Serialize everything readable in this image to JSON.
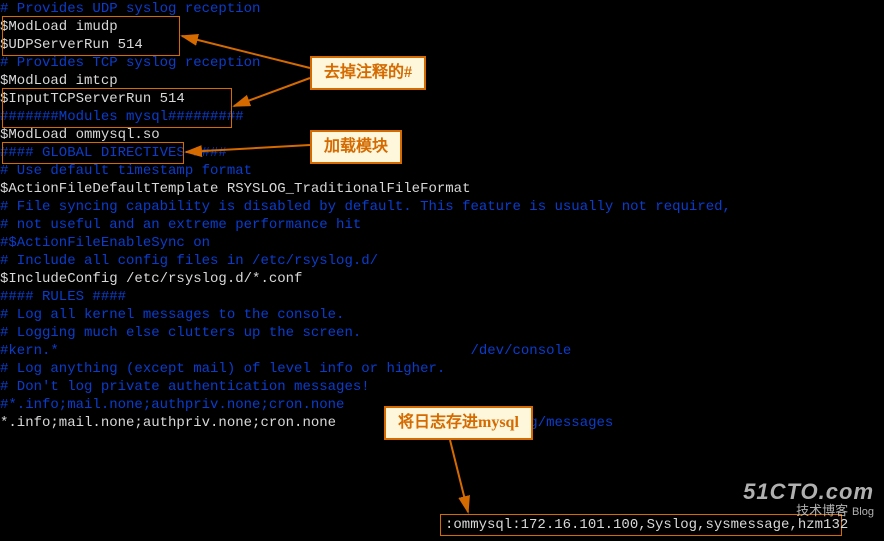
{
  "code": {
    "l1": "# Provides UDP syslog reception",
    "l2": "$ModLoad imudp",
    "l3": "$UDPServerRun 514",
    "l4": "",
    "l5": "# Provides TCP syslog reception",
    "l6": "$ModLoad imtcp",
    "l7": "$InputTCPServerRun 514",
    "l8": "#######Modules mysql#########",
    "l9": "$ModLoad ommysql.so",
    "l10": "",
    "l11": "#### GLOBAL DIRECTIVES ####",
    "l12": "",
    "l13": "# Use default timestamp format",
    "l14": "$ActionFileDefaultTemplate RSYSLOG_TraditionalFileFormat",
    "l15": "",
    "l16": "# File syncing capability is disabled by default. This feature is usually not required,",
    "l17": "# not useful and an extreme performance hit",
    "l18": "#$ActionFileEnableSync on",
    "l19": "",
    "l20": "# Include all config files in /etc/rsyslog.d/",
    "l21": "$IncludeConfig /etc/rsyslog.d/*.conf",
    "l22": "",
    "l23": "",
    "l24": "#### RULES ####",
    "l25": "",
    "l26": "# Log all kernel messages to the console.",
    "l27": "# Logging much else clutters up the screen.",
    "l28": "#kern.*                                                 /dev/console",
    "l29": "",
    "l30": "# Log anything (except mail) of level info or higher.",
    "l31": "# Don't log private authentication messages!",
    "l32": "#*.info;mail.none;authpriv.none;cron.none",
    "l33a": "*.info;mail.none;authpriv.none;cron.none",
    "l33b": "                /var/log/messages",
    "l33c": ":ommysql:172.16.101.100,Syslog,sysmessage,hzm132"
  },
  "callouts": {
    "c1": "去掉注释的#",
    "c2": "加载模块",
    "c3": "将日志存进mysql"
  },
  "watermark": {
    "site": "51CTO.com",
    "sub": "技术博客",
    "tag": "Blog"
  }
}
